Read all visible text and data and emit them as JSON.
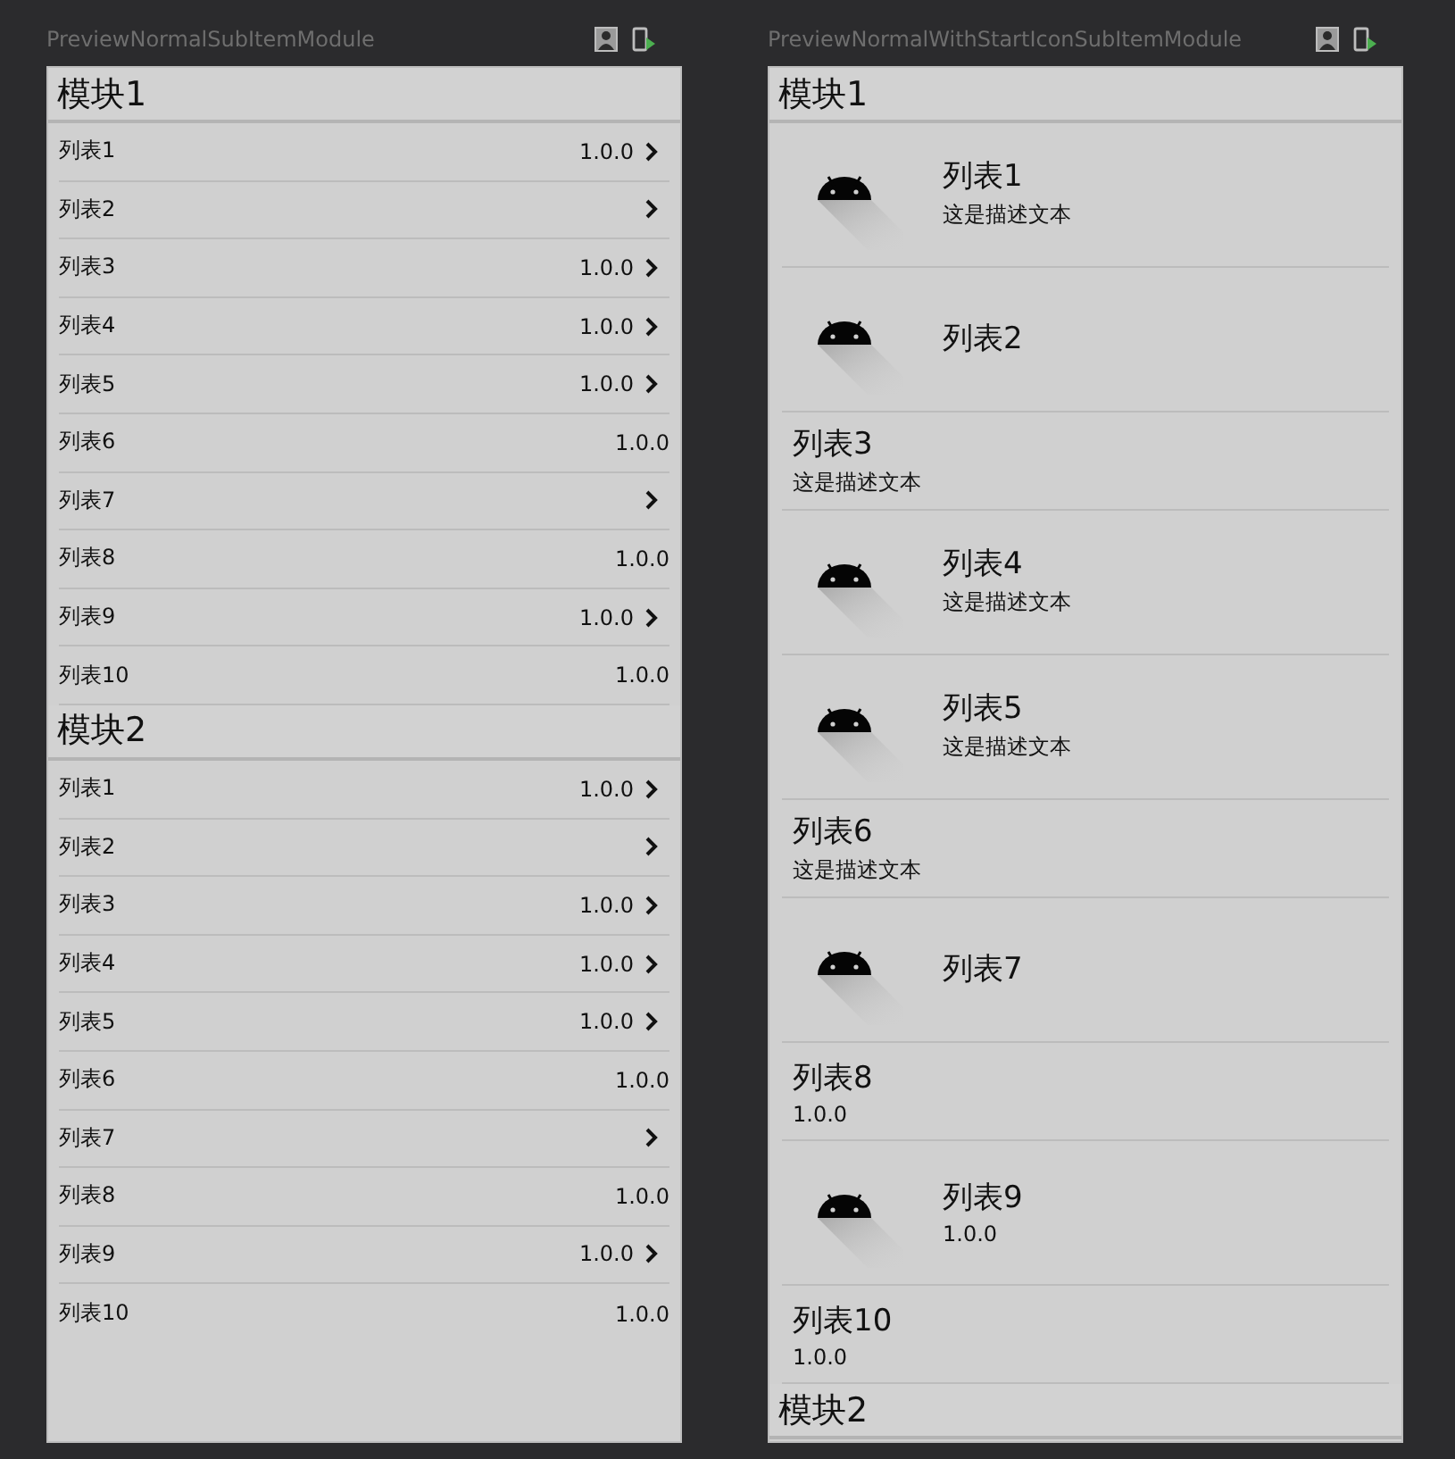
{
  "previews": [
    {
      "title": "PreviewNormalSubItemModule",
      "kind": "normal",
      "modules": [
        {
          "title": "模块1",
          "items": [
            {
              "label": "列表1",
              "version": "1.0.0",
              "arrow": true
            },
            {
              "label": "列表2",
              "arrow": true
            },
            {
              "label": "列表3",
              "version": "1.0.0",
              "arrow": true
            },
            {
              "label": "列表4",
              "version": "1.0.0",
              "arrow": true
            },
            {
              "label": "列表5",
              "version": "1.0.0",
              "arrow": true
            },
            {
              "label": "列表6",
              "version": "1.0.0",
              "arrow": false
            },
            {
              "label": "列表7",
              "arrow": true
            },
            {
              "label": "列表8",
              "version": "1.0.0",
              "arrow": false
            },
            {
              "label": "列表9",
              "version": "1.0.0",
              "arrow": true
            },
            {
              "label": "列表10",
              "version": "1.0.0",
              "arrow": false
            }
          ]
        },
        {
          "title": "模块2",
          "items": [
            {
              "label": "列表1",
              "version": "1.0.0",
              "arrow": true
            },
            {
              "label": "列表2",
              "arrow": true
            },
            {
              "label": "列表3",
              "version": "1.0.0",
              "arrow": true
            },
            {
              "label": "列表4",
              "version": "1.0.0",
              "arrow": true
            },
            {
              "label": "列表5",
              "version": "1.0.0",
              "arrow": true
            },
            {
              "label": "列表6",
              "version": "1.0.0",
              "arrow": false
            },
            {
              "label": "列表7",
              "arrow": true
            },
            {
              "label": "列表8",
              "version": "1.0.0",
              "arrow": false
            },
            {
              "label": "列表9",
              "version": "1.0.0",
              "arrow": true
            },
            {
              "label": "列表10",
              "version": "1.0.0",
              "arrow": false
            }
          ]
        }
      ]
    },
    {
      "title": "PreviewNormalWithStartIconSubItemModule",
      "kind": "start_icon",
      "modules": [
        {
          "title": "模块1",
          "items": [
            {
              "kind": "icon",
              "label": "列表1",
              "subtitle": "这是描述文本"
            },
            {
              "kind": "icon",
              "label": "列表2"
            },
            {
              "kind": "text",
              "label": "列表3",
              "subtitle": "这是描述文本"
            },
            {
              "kind": "icon",
              "label": "列表4",
              "subtitle": "这是描述文本"
            },
            {
              "kind": "icon",
              "label": "列表5",
              "subtitle": "这是描述文本"
            },
            {
              "kind": "text",
              "label": "列表6",
              "subtitle": "这是描述文本"
            },
            {
              "kind": "icon",
              "label": "列表7"
            },
            {
              "kind": "text",
              "label": "列表8",
              "subtitle": "1.0.0"
            },
            {
              "kind": "icon",
              "label": "列表9",
              "subtitle": "1.0.0"
            },
            {
              "kind": "text",
              "label": "列表10",
              "subtitle": "1.0.0"
            }
          ]
        },
        {
          "title": "模块2"
        }
      ]
    }
  ]
}
